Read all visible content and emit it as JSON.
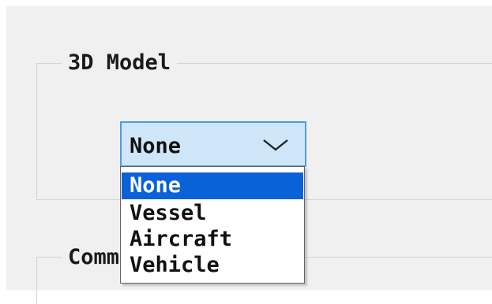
{
  "model_group": {
    "title": "3D Model"
  },
  "model_combo": {
    "value": "None",
    "expanded": true,
    "icon": "chevron-down-icon",
    "options": [
      "None",
      "Vessel",
      "Aircraft",
      "Vehicle"
    ],
    "selected_option": "None"
  },
  "comm_group": {
    "title_start": "Comm",
    "title_end": "om"
  },
  "colors": {
    "selection": "#0a62d8",
    "combo_focus_border": "#4f9be0",
    "combo_focus_fill": "#cfe6f8",
    "dialog_background": "#f0f0f0"
  }
}
